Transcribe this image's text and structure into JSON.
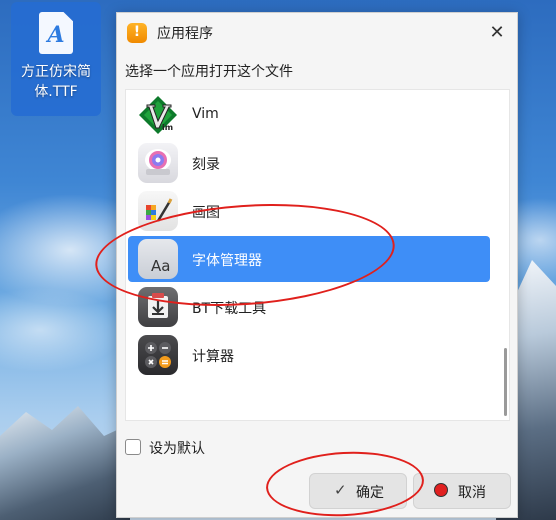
{
  "desktop": {
    "file_icon": {
      "glyph": "A",
      "label": "方正仿宋简体.TTF",
      "icon": "ttf-font-file-icon"
    }
  },
  "dialog": {
    "title": "应用程序",
    "title_icon": {
      "glyph": "!",
      "icon": "app-warning-icon",
      "color": "#f5a00a"
    },
    "close_glyph": "✕",
    "prompt": "选择一个应用打开这个文件",
    "apps": [
      {
        "label": "Vim",
        "icon": "vim-icon"
      },
      {
        "label": "刻录",
        "icon": "disc-burner-icon"
      },
      {
        "label": "画图",
        "icon": "paint-icon"
      },
      {
        "label": "字体管理器",
        "icon": "font-manager-icon",
        "icon_text": "Aa",
        "selected": true
      },
      {
        "label": "BT下载工具",
        "icon": "bt-download-icon"
      },
      {
        "label": "计算器",
        "icon": "calculator-icon"
      }
    ],
    "set_default": {
      "label": "设为默认",
      "checked": false
    },
    "ok_button": {
      "label": "确定",
      "icon": "✓"
    },
    "cancel_button": {
      "label": "取消"
    }
  },
  "colors": {
    "selection": "#3e8ef7",
    "annotation": "#e0201c"
  }
}
